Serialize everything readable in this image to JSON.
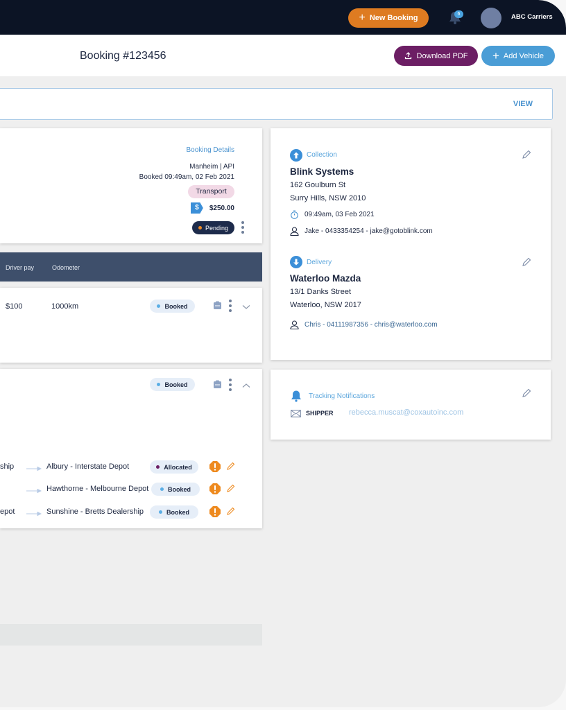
{
  "topbar": {
    "new_booking_label": "New Booking",
    "notification_count": "6",
    "account_name": "ABC Carriers"
  },
  "header": {
    "title": "Booking #123456",
    "download_pdf_label": "Download PDF",
    "add_vehicle_label": "Add Vehicle"
  },
  "view_bar": {
    "view_label": "VIEW"
  },
  "booking_details": {
    "title": "Booking Details",
    "source": "Manheim | API",
    "booked_at": "Booked 09:49am, 02 Feb 2021",
    "service_tag": "Transport",
    "price_icon": "$",
    "price": "$250.00",
    "status": "Pending",
    "status_dot_color": "#f08a24"
  },
  "vehicle_table": {
    "columns": [
      "Driver pay",
      "Odometer"
    ],
    "rows": [
      {
        "driver_pay": "$100",
        "odometer": "1000km",
        "status": "Booked",
        "expanded": false
      }
    ]
  },
  "vehicle_2": {
    "status": "Booked",
    "legs": [
      {
        "from": "ship",
        "to": "Albury - Interstate Depot",
        "status": "Allocated",
        "dot_color": "#6c1e64"
      },
      {
        "from": "",
        "to": "Hawthorne - Melbourne Depot",
        "status": "Booked",
        "dot_color": "#5aaee5"
      },
      {
        "from": "epot",
        "to": "Sunshine - Bretts Dealership",
        "status": "Booked",
        "dot_color": "#5aaee5"
      }
    ]
  },
  "collection": {
    "label": "Collection",
    "company": "Blink Systems",
    "street": "162 Goulburn St",
    "suburb": "Surry Hills, NSW 2010",
    "time": "09:49am, 03 Feb 2021",
    "contact": "Jake - 0433354254 - jake@gotoblink.com"
  },
  "delivery": {
    "label": "Delivery",
    "company": "Waterloo Mazda",
    "street": "13/1 Danks Street",
    "suburb": "Waterloo, NSW 2017",
    "contact": "Chris - 04111987356 - chris@waterloo.com"
  },
  "tracking": {
    "label": "Tracking Notifications",
    "role": "SHIPPER",
    "email": "rebecca.muscat@coxautoinc.com"
  },
  "colors": {
    "navy": "#0c1425",
    "orange": "#de7b21",
    "purple": "#6c1e64",
    "blue": "#4a9dd6",
    "booked_dot": "#5aaee5"
  }
}
